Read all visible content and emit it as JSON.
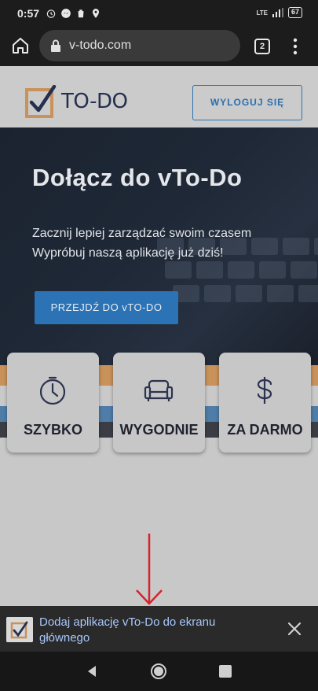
{
  "status_bar": {
    "time": "0:57",
    "network": "LTE",
    "battery": "67",
    "icons": [
      "alarm-icon",
      "messenger-icon",
      "trash-icon",
      "location-icon",
      "signal-icon",
      "battery-icon"
    ]
  },
  "browser": {
    "url": "v-todo.com",
    "tab_count": "2",
    "icons": [
      "home-icon",
      "lock-icon",
      "tabs-icon",
      "more-vert-icon"
    ]
  },
  "header": {
    "logo_text": "TO-DO",
    "logout_label": "WYLOGUJ SIĘ"
  },
  "hero": {
    "title": "Dołącz do vTo-Do",
    "subtitle_line1": "Zacznij lepiej zarządzać swoim czasem",
    "subtitle_line2": "Wypróbuj naszą aplikację już dziś!",
    "cta_label": "PRZEJDŹ DO vTO-DO"
  },
  "features": [
    {
      "label": "SZYBKO",
      "icon": "stopwatch-icon"
    },
    {
      "label": "WYGODNIE",
      "icon": "sofa-icon"
    },
    {
      "label": "ZA DARMO",
      "icon": "dollar-icon"
    }
  ],
  "install_banner": {
    "text": "Dodaj aplikację vTo-Do do ekranu głównego"
  },
  "colors": {
    "accent_blue": "#2b73b5",
    "logo_orange": "#c8925a",
    "arrow_red": "#d8232a",
    "banner_link": "#a8c7fa"
  }
}
